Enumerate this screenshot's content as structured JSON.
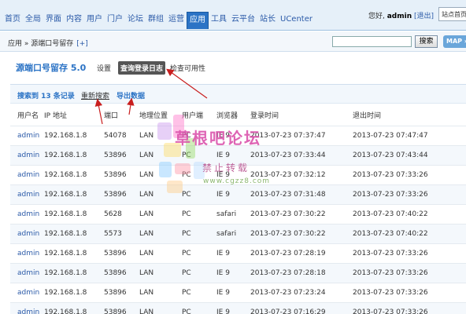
{
  "nav": {
    "items": [
      "首页",
      "全局",
      "界面",
      "内容",
      "用户",
      "门户",
      "论坛",
      "群组",
      "运营",
      "应用",
      "工具",
      "云平台",
      "站长",
      "UCenter"
    ],
    "active_index": 9
  },
  "user": {
    "greeting": "您好, ",
    "name": "admin",
    "logout": "[退出]",
    "site_select": "站点首页"
  },
  "breadcrumb": {
    "text": "应用 » 源端口号留存",
    "add": "[+]"
  },
  "search": {
    "value": "",
    "button": "搜索"
  },
  "map_button": "MAP »",
  "plugin": {
    "title": "源端口号留存  5.0",
    "menu": [
      "设置",
      "查询登录日志",
      "检查可用性"
    ],
    "active_menu": 1
  },
  "toolbar": {
    "count": "搜索到 13 条记录",
    "reset": "重新搜索",
    "export": "导出数据"
  },
  "table": {
    "headers": [
      "用户名",
      "IP 地址",
      "端口",
      "地理位置",
      "用户端",
      "浏览器",
      "登录时间",
      "退出时间"
    ],
    "rows": [
      [
        "admin",
        "192.168.1.8",
        "54078",
        "LAN",
        "PC",
        "IE 9",
        "2013-07-23 07:37:47",
        "2013-07-23 07:47:47"
      ],
      [
        "admin",
        "192.168.1.8",
        "53896",
        "LAN",
        "PC",
        "IE 9",
        "2013-07-23 07:33:44",
        "2013-07-23 07:43:44"
      ],
      [
        "admin",
        "192.168.1.8",
        "53896",
        "LAN",
        "PC",
        "IE 9",
        "2013-07-23 07:32:12",
        "2013-07-23 07:33:26"
      ],
      [
        "admin",
        "192.168.1.8",
        "53896",
        "LAN",
        "PC",
        "IE 9",
        "2013-07-23 07:31:48",
        "2013-07-23 07:33:26"
      ],
      [
        "admin",
        "192.168.1.8",
        "5628",
        "LAN",
        "PC",
        "safari",
        "2013-07-23 07:30:22",
        "2013-07-23 07:40:22"
      ],
      [
        "admin",
        "192.168.1.8",
        "5573",
        "LAN",
        "PC",
        "safari",
        "2013-07-23 07:30:22",
        "2013-07-23 07:40:22"
      ],
      [
        "admin",
        "192.168.1.8",
        "53896",
        "LAN",
        "PC",
        "IE 9",
        "2013-07-23 07:28:19",
        "2013-07-23 07:33:26"
      ],
      [
        "admin",
        "192.168.1.8",
        "53896",
        "LAN",
        "PC",
        "IE 9",
        "2013-07-23 07:28:18",
        "2013-07-23 07:33:26"
      ],
      [
        "admin",
        "192.168.1.8",
        "53896",
        "LAN",
        "PC",
        "IE 9",
        "2013-07-23 07:23:24",
        "2013-07-23 07:33:26"
      ],
      [
        "admin",
        "192.168.1.8",
        "53896",
        "LAN",
        "PC",
        "IE 9",
        "2013-07-23 07:16:29",
        "2013-07-23 07:33:26"
      ]
    ]
  },
  "watermark": {
    "title": "草根吧论坛",
    "subtitle": "禁止转载",
    "url": "www.cgzz8.com"
  },
  "colors": {
    "accent": "#2b73c5",
    "link": "#2b5aa8",
    "nav_bg": "#e6f0f9",
    "arrow": "#c81e1e"
  }
}
